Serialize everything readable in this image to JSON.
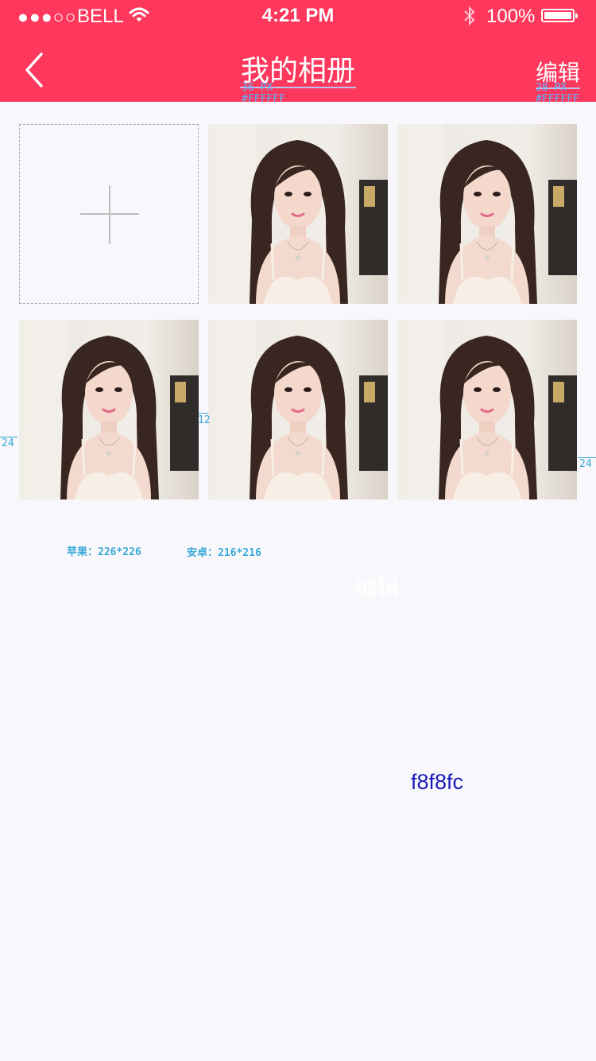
{
  "status_bar": {
    "signal": "●●●○○",
    "carrier": "BELL",
    "time": "4:21 PM",
    "battery": "100%"
  },
  "nav": {
    "title": "我的相册",
    "edit_label": "编辑",
    "title_spec_size": "36 PX",
    "title_spec_color": "#FFFFFF",
    "edit_spec_size": "28 PX",
    "edit_spec_color": "#FFFFFF"
  },
  "album": {
    "add_icon": "plus-icon",
    "photos": [
      {
        "alt": "photo"
      },
      {
        "alt": "photo"
      },
      {
        "alt": "photo"
      },
      {
        "alt": "photo"
      },
      {
        "alt": "photo"
      }
    ]
  },
  "annotations": {
    "margin_left": "24",
    "gap": "12",
    "margin_right": "24",
    "apple_size": "苹果：226*226",
    "android_size": "安卓：216*216",
    "ghost_edit": "编辑",
    "bg_color_label": "f8f8fc"
  },
  "colors": {
    "header": "#fe375c",
    "background": "#f8f8fc",
    "annotation": "#3aa9d8"
  }
}
